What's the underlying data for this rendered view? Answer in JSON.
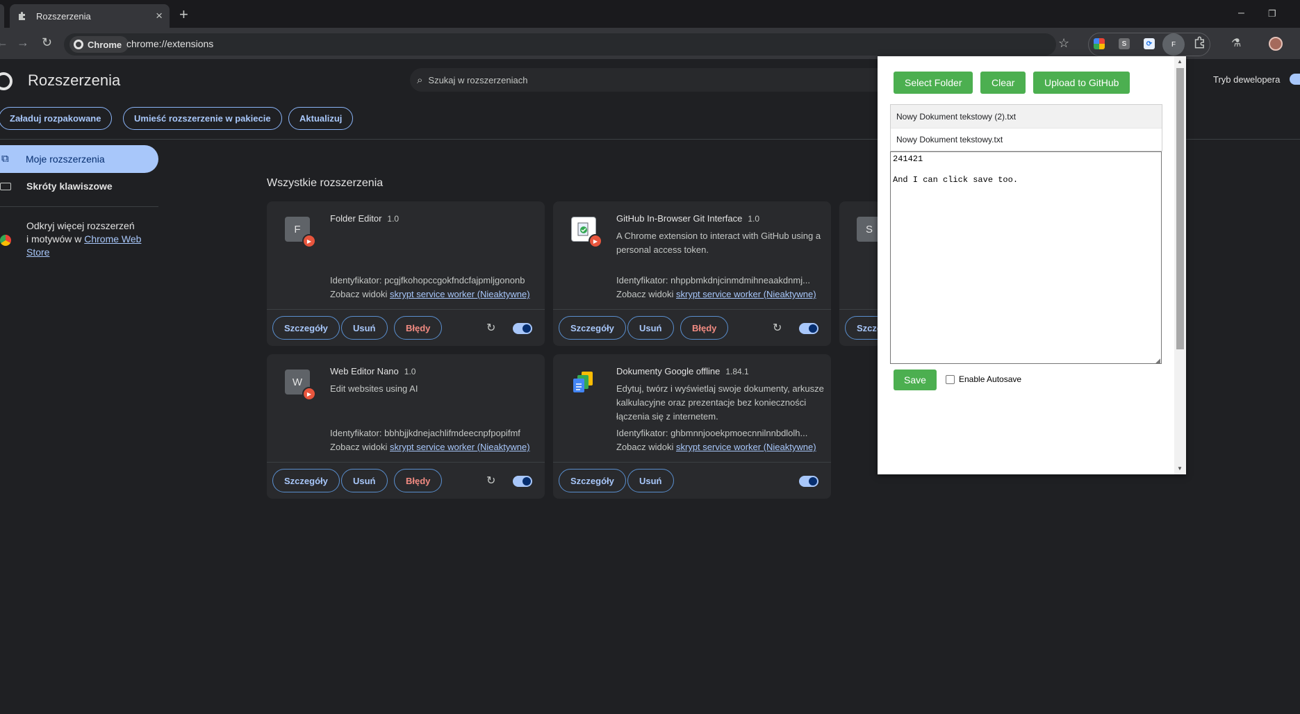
{
  "tab": {
    "title": "Rozszerzenia"
  },
  "omnibox": {
    "chip": "Chrome",
    "url": "chrome://extensions"
  },
  "toolbar_ext": {
    "f_label": "F",
    "s_label": "S"
  },
  "page": {
    "title": "Rozszerzenia",
    "search_placeholder": "Szukaj w rozszerzeniach",
    "dev_mode_label": "Tryb dewelopera",
    "buttons": {
      "load": "Załaduj rozpakowane",
      "pack": "Umieść rozszerzenie w pakiecie",
      "update": "Aktualizuj"
    },
    "section_title": "Wszystkie rozszerzenia"
  },
  "sidebar": {
    "mine": "Moje rozszerzenia",
    "shortcuts": "Skróty klawiszowe",
    "discover_line1": "Odkryj więcej rozszerzeń",
    "discover_line2": "i motywów w",
    "discover_link": "Chrome Web Store"
  },
  "labels": {
    "id_prefix": "Identyfikator:",
    "views_prefix": "Zobacz widoki",
    "details": "Szczegóły",
    "remove": "Usuń",
    "errors": "Błędy"
  },
  "cards": [
    {
      "icon_letter": "F",
      "name": "Folder Editor",
      "version": "1.0",
      "desc": "",
      "id": "pcgjfkohopccgokfndcfajpmljgononb",
      "views_link": "skrypt service worker (Nieaktywne)"
    },
    {
      "icon_letter": "",
      "name": "GitHub In-Browser Git Interface",
      "version": "1.0",
      "desc": "A Chrome extension to interact with GitHub using a personal access token.",
      "id": "nhppbmkdnjcinmdmihneaakdnmj...",
      "views_link": "skrypt service worker (Nieaktywne)"
    },
    {
      "icon_letter": "S",
      "partial_button": "Szcze"
    },
    {
      "icon_letter": "W",
      "name": "Web Editor Nano",
      "version": "1.0",
      "desc": "Edit websites using AI",
      "id": "bbhbjjkdnejachlifmdeecnpfpopifmf",
      "views_link": "skrypt service worker (Nieaktywne)"
    },
    {
      "icon_letter": "",
      "name": "Dokumenty Google offline",
      "version": "1.84.1",
      "desc": "Edytuj, twórz i wyświetlaj swoje dokumenty, arkusze kalkulacyjne oraz prezentacje bez konieczności łączenia się z internetem.",
      "id": "ghbmnnjooekpmoecnnilnnbdlolh...",
      "views_link": "skrypt service worker (Nieaktywne)"
    }
  ],
  "popup": {
    "select_folder": "Select Folder",
    "clear": "Clear",
    "upload": "Upload to GitHub",
    "files": [
      "Nowy Dokument tekstowy (2).txt",
      "Nowy Dokument tekstowy.txt"
    ],
    "editor_text": "241421\n\nAnd I can click save too.",
    "save": "Save",
    "autosave_label": "Enable Autosave"
  },
  "colors": {
    "accent": "#a8c7fa",
    "popup_button": "#4caf50",
    "error": "#f28b82",
    "badge": "#e8553d"
  }
}
